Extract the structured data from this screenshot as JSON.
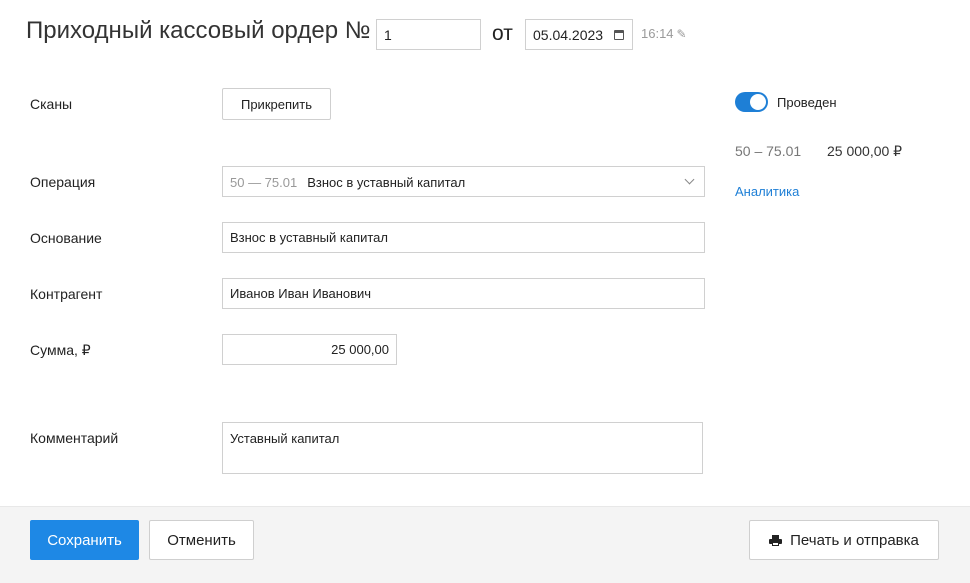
{
  "header": {
    "title": "Приходный кассовый ордер №",
    "number_value": "1",
    "ot_label": "от",
    "date_value": "05.04.2023",
    "time": "16:14"
  },
  "form": {
    "scans_label": "Сканы",
    "attach_button": "Прикрепить",
    "operation_label": "Операция",
    "operation_code": "50 — 75.01",
    "operation_value": "Взнос в уставный капитал",
    "basis_label": "Основание",
    "basis_value": "Взнос в уставный капитал",
    "counterparty_label": "Контрагент",
    "counterparty_value": "Иванов Иван Иванович",
    "sum_label": "Сумма, ₽",
    "sum_value": "25 000,00",
    "comment_label": "Комментарий",
    "comment_value": "Уставный капитал"
  },
  "side": {
    "posted_label": "Проведен",
    "posted": true,
    "entry_code": "50 – 75.01",
    "entry_amount": "25 000,00 ₽",
    "analytics_link": "Аналитика"
  },
  "footer": {
    "save_button": "Сохранить",
    "cancel_button": "Отменить",
    "print_button": "Печать и отправка"
  },
  "colors": {
    "accent": "#1e88e5",
    "link": "#1e7fd6"
  }
}
